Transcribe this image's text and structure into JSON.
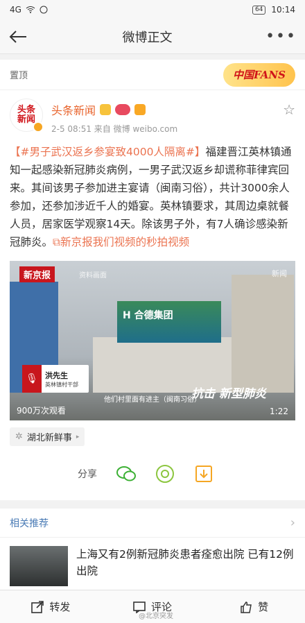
{
  "status": {
    "left_text": "4G",
    "battery": "64",
    "time": "10:14"
  },
  "nav": {
    "title": "微博正文"
  },
  "pinned": {
    "label": "置顶",
    "badge": "中国FANS"
  },
  "author": {
    "name": "头条新闻",
    "meta": "2-5 08:51  来自 微博 weibo.com",
    "avatar_text": "头条新闻"
  },
  "post": {
    "topic": "【#男子武汉返乡参宴致4000人隔离#】",
    "body": "福建晋江英林镇通知一起感染新冠肺炎病例，一男子武汉返乡却谎称菲律宾回来。其间该男子参加进主宴请（闽南习俗），共计3000余人参加，还参加涉近千人的婚宴。英林镇要求，其周边桌就餐人员，居家医学观察14天。除该男子外，有7人确诊感染新冠肺炎。",
    "link": "新京报我们视频的秒拍视频"
  },
  "video": {
    "brand": "新京报",
    "source": "资料画面",
    "billboard": "H 合德集团",
    "speaker_name": "洪先生",
    "speaker_role": "英林镇村干部",
    "caption": "他们村里面有进主（闽南习俗）",
    "views": "900万次观看",
    "duration": "1:22",
    "watermark": "新闻",
    "overlay": "抗击 新型肺炎"
  },
  "tag": {
    "label": "湖北新鲜事"
  },
  "share": {
    "label": "分享"
  },
  "recommend": {
    "title": "相关推荐",
    "item_text": "上海又有2例新冠肺炎患者痊愈出院 已有12例出院"
  },
  "bottom": {
    "repost": "转发",
    "comment": "评论",
    "like": "赞",
    "watermark": "@北京突发"
  }
}
